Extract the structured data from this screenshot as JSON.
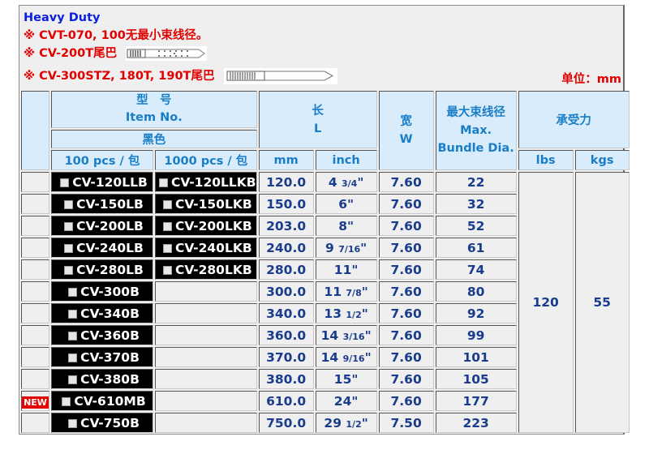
{
  "notes": {
    "title": "Heavy Duty",
    "line1": "※ CVT-070, 100无最小束线径。",
    "line2": "※ CV-200T尾巴",
    "line3": "※ CV-300STZ, 180T, 190T尾巴",
    "unit": "单位：mm"
  },
  "header": {
    "item_cn": "型　号",
    "item_en": "Item No.",
    "color": "黑色",
    "pack100": "100 pcs / 包",
    "pack1000": "1000 pcs / 包",
    "length_cn": "长",
    "length_en": "L",
    "mm": "mm",
    "inch": "inch",
    "width_cn": "宽",
    "width_en": "W",
    "dia_cn": "最大束线径",
    "dia_en1": "Max.",
    "dia_en2": "Bundle Dia.",
    "force_cn": "承受力",
    "lbs": "lbs",
    "kgs": "kgs"
  },
  "tensile": {
    "lbs": "120",
    "kgs": "55"
  },
  "badge": "NEW",
  "colors": {
    "header_bg": "#d9ecfb",
    "header_text": "#1a7ec6",
    "data_text": "#1a3c8c",
    "note_red": "#e00000",
    "title_blue": "#0a1edc"
  },
  "rows": [
    {
      "new": false,
      "item100": "CV-120LLB",
      "item1000": "CV-120LLKB",
      "mm": "120.0",
      "inch_whole": "4",
      "inch_frac": "3/4",
      "width": "7.60",
      "dia": "22"
    },
    {
      "new": false,
      "item100": "CV-150LB",
      "item1000": "CV-150LKB",
      "mm": "150.0",
      "inch_whole": "6",
      "inch_frac": "",
      "width": "7.60",
      "dia": "32"
    },
    {
      "new": false,
      "item100": "CV-200LB",
      "item1000": "CV-200LKB",
      "mm": "203.0",
      "inch_whole": "8",
      "inch_frac": "",
      "width": "7.60",
      "dia": "52"
    },
    {
      "new": false,
      "item100": "CV-240LB",
      "item1000": "CV-240LKB",
      "mm": "240.0",
      "inch_whole": "9",
      "inch_frac": "7/16",
      "width": "7.60",
      "dia": "61"
    },
    {
      "new": false,
      "item100": "CV-280LB",
      "item1000": "CV-280LKB",
      "mm": "280.0",
      "inch_whole": "11",
      "inch_frac": "",
      "width": "7.60",
      "dia": "74"
    },
    {
      "new": false,
      "item100": "CV-300B",
      "item1000": "",
      "mm": "300.0",
      "inch_whole": "11",
      "inch_frac": "7/8",
      "width": "7.60",
      "dia": "80"
    },
    {
      "new": false,
      "item100": "CV-340B",
      "item1000": "",
      "mm": "340.0",
      "inch_whole": "13",
      "inch_frac": "1/2",
      "width": "7.60",
      "dia": "92"
    },
    {
      "new": false,
      "item100": "CV-360B",
      "item1000": "",
      "mm": "360.0",
      "inch_whole": "14",
      "inch_frac": "3/16",
      "width": "7.60",
      "dia": "99"
    },
    {
      "new": false,
      "item100": "CV-370B",
      "item1000": "",
      "mm": "370.0",
      "inch_whole": "14",
      "inch_frac": "9/16",
      "width": "7.60",
      "dia": "101"
    },
    {
      "new": false,
      "item100": "CV-380B",
      "item1000": "",
      "mm": "380.0",
      "inch_whole": "15",
      "inch_frac": "",
      "width": "7.60",
      "dia": "105"
    },
    {
      "new": true,
      "item100": "CV-610MB",
      "item1000": "",
      "mm": "610.0",
      "inch_whole": "24",
      "inch_frac": "",
      "width": "7.60",
      "dia": "177"
    },
    {
      "new": false,
      "item100": "CV-750B",
      "item1000": "",
      "mm": "750.0",
      "inch_whole": "29",
      "inch_frac": "1/2",
      "width": "7.50",
      "dia": "223"
    }
  ]
}
